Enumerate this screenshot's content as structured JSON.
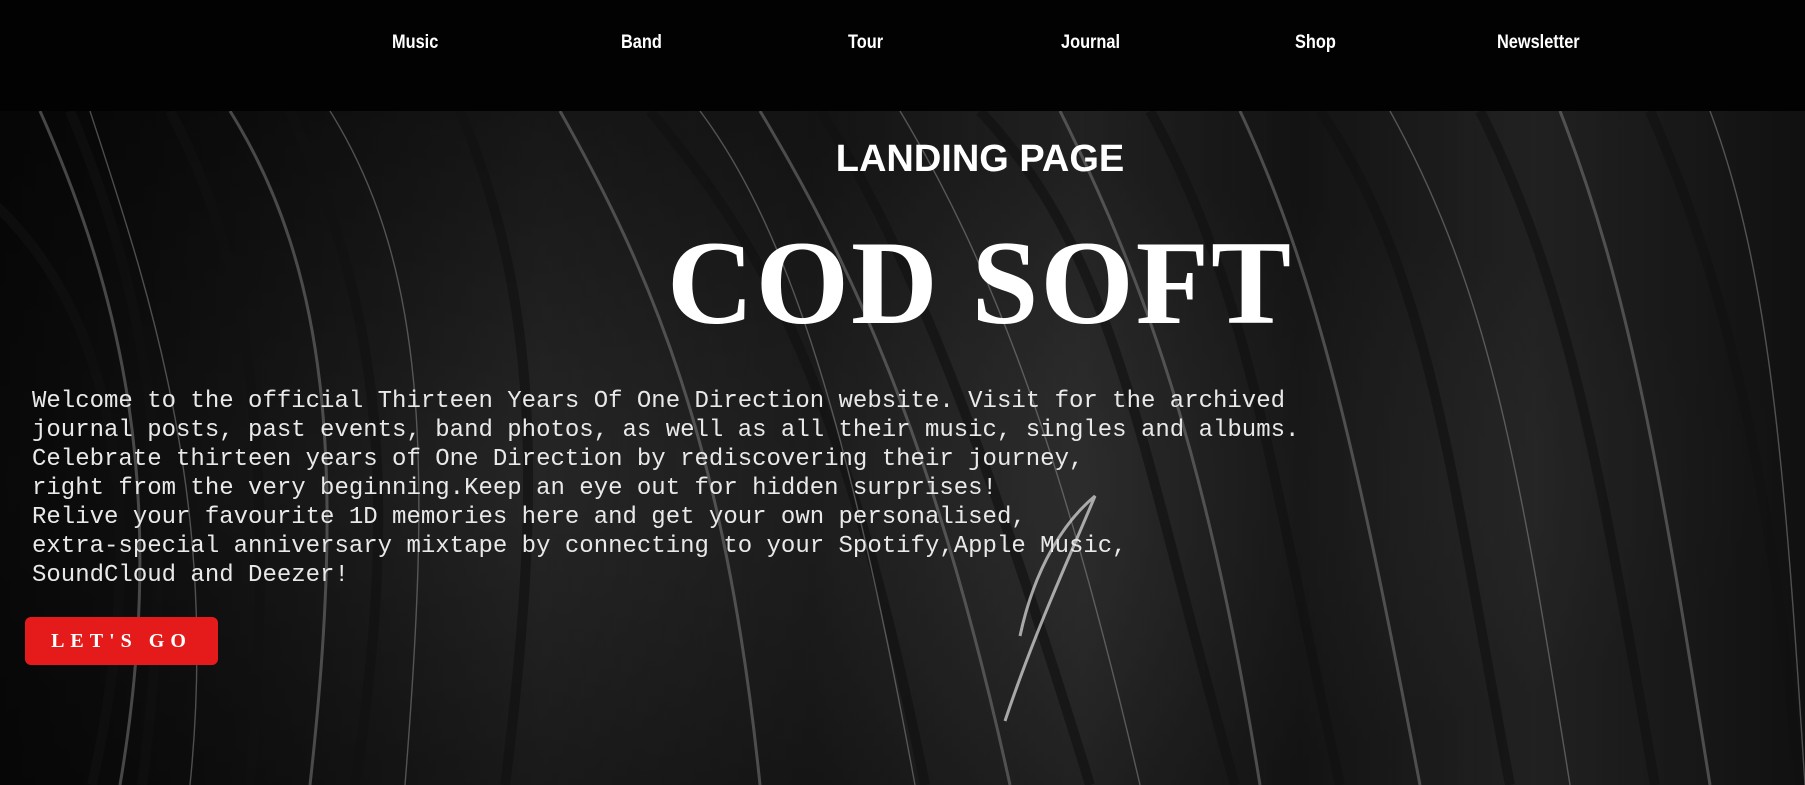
{
  "nav": {
    "items": [
      {
        "label": "Music"
      },
      {
        "label": "Band"
      },
      {
        "label": "Tour"
      },
      {
        "label": "Journal"
      },
      {
        "label": "Shop"
      },
      {
        "label": "Newsletter"
      }
    ]
  },
  "hero": {
    "eyebrow": "LANDING PAGE",
    "title": "COD SOFT",
    "intro": "Welcome to the official Thirteen Years Of One Direction website. Visit for the archived\njournal posts, past events, band photos, as well as all their music, singles and albums.\nCelebrate thirteen years of One Direction by rediscovering their journey,\nright from the very beginning.Keep an eye out for hidden surprises!\nRelive your favourite 1D memories here and get your own personalised,\nextra-special anniversary mixtape by connecting to your Spotify,Apple Music,\nSoundCloud and Deezer!",
    "cta_label": "LET'S GO"
  },
  "colors": {
    "nav_background": "#020202",
    "text": "#ffffff",
    "cta_background": "#e51b1b",
    "hero_background": "#2a2a2a"
  }
}
